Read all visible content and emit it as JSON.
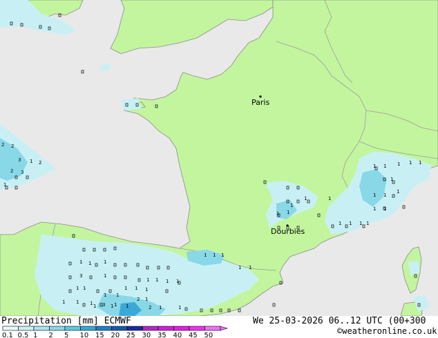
{
  "footer": {
    "title": "Precipitation [mm] ECMWF",
    "datetime": "We 25-03-2026 06..12 UTC (00+300",
    "credit": "©weatheronline.co.uk"
  },
  "legend": {
    "labels": [
      "0.1",
      "0.5",
      "1",
      "2",
      "5",
      "10",
      "15",
      "20",
      "25",
      "30",
      "35",
      "40",
      "45",
      "50"
    ],
    "colors": [
      "#e8fafa",
      "#c8f0f4",
      "#a8e6ee",
      "#88d8e8",
      "#60c8e0",
      "#3aa8d8",
      "#2080c8",
      "#1858b0",
      "#1a2aa0",
      "#b428c8",
      "#d020d8",
      "#e020e0",
      "#f030f0",
      "#f070f8"
    ]
  },
  "cities": [
    {
      "name": "Paris"
    },
    {
      "name": "Dourbies"
    }
  ],
  "grid_numbers": [
    "2",
    "2",
    "3",
    "1",
    "2",
    "1",
    "1",
    "1",
    "1",
    "3",
    "1",
    "1",
    "1",
    "1",
    "1",
    "1",
    "1",
    "1",
    "2",
    "1",
    "1",
    "1",
    "1",
    "1",
    "3",
    "1",
    "1",
    "1",
    "1",
    "1",
    "1",
    "1",
    "1",
    "1",
    "1",
    "1",
    "1",
    "1",
    "1",
    "1",
    "1",
    "1",
    "1",
    "1",
    "1",
    "1",
    "1",
    "1",
    "1",
    "1",
    "1",
    "1",
    "2",
    "3",
    "1",
    "1",
    "1",
    "1",
    "1",
    "1",
    "2",
    "1"
  ],
  "colors": {
    "sea": "#e9e9e9",
    "land": "#c3f59f",
    "border": "#9a9a9a",
    "precip_light": "#c8f0f4",
    "precip_mid": "#88d8e8"
  }
}
